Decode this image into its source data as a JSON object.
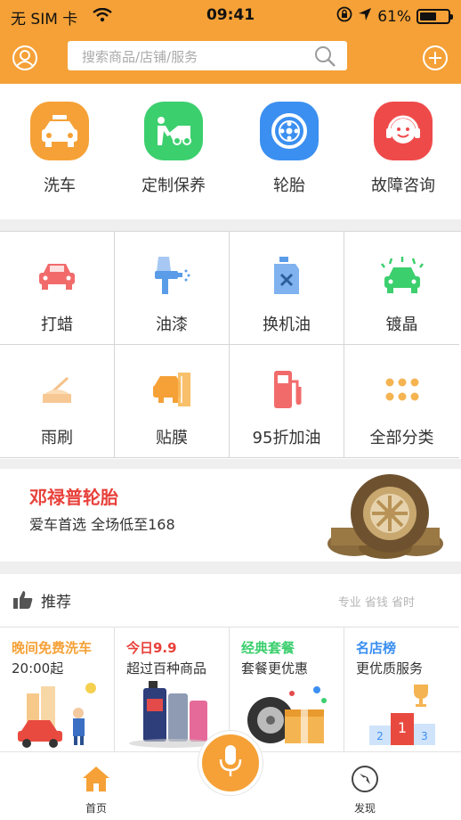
{
  "status": {
    "carrier": "无 SIM 卡",
    "time": "09:41",
    "battery": "61%",
    "battery_level": 0.61
  },
  "search": {
    "placeholder": "搜索商品/店铺/服务"
  },
  "top_categories": [
    {
      "label": "洗车",
      "icon": "car-wash-icon",
      "color": "#f5a137"
    },
    {
      "label": "定制保养",
      "icon": "maintenance-icon",
      "color": "#3ccf6e"
    },
    {
      "label": "轮胎",
      "icon": "tire-icon",
      "color": "#3b8ff0"
    },
    {
      "label": "故障咨询",
      "icon": "support-icon",
      "color": "#ef4a4a"
    }
  ],
  "services": [
    {
      "label": "打蜡",
      "icon": "wax-icon"
    },
    {
      "label": "油漆",
      "icon": "paint-gun-icon"
    },
    {
      "label": "换机油",
      "icon": "oil-can-icon"
    },
    {
      "label": "镀晶",
      "icon": "coating-icon"
    },
    {
      "label": "雨刷",
      "icon": "wiper-icon"
    },
    {
      "label": "贴膜",
      "icon": "film-icon"
    },
    {
      "label": "95折加油",
      "icon": "fuel-icon"
    },
    {
      "label": "全部分类",
      "icon": "all-categories-icon"
    }
  ],
  "banner": {
    "title": "邓禄普轮胎",
    "subtitle": "爱车首选  全场低至168"
  },
  "recommend": {
    "title": "推荐",
    "tags": "专业 省钱 省时"
  },
  "cards": [
    {
      "title": "晚间免费洗车",
      "subtitle": "20:00起",
      "color": "#f5a137"
    },
    {
      "title": "今日9.9",
      "subtitle": "超过百种商品",
      "color": "#e8403a"
    },
    {
      "title": "经典套餐",
      "subtitle": "套餐更优惠",
      "color": "#3ccf6e"
    },
    {
      "title": "名店榜",
      "subtitle": "更优质服务",
      "color": "#3b8ff0"
    }
  ],
  "tabs": {
    "home": "首页",
    "discover": "发现"
  }
}
